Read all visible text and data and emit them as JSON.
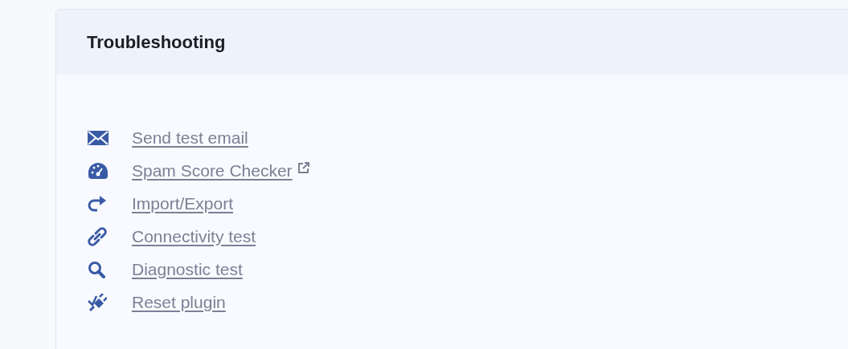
{
  "panel": {
    "title": "Troubleshooting",
    "links": [
      {
        "kind": "mail",
        "label": "Send test email",
        "external": false
      },
      {
        "kind": "gauge",
        "label": "Spam Score Checker",
        "external": true
      },
      {
        "kind": "redo",
        "label": "Import/Export",
        "external": false
      },
      {
        "kind": "link",
        "label": "Connectivity test",
        "external": false
      },
      {
        "kind": "search",
        "label": "Diagnostic test",
        "external": false
      },
      {
        "kind": "plug",
        "label": "Reset plugin",
        "external": false
      }
    ]
  }
}
